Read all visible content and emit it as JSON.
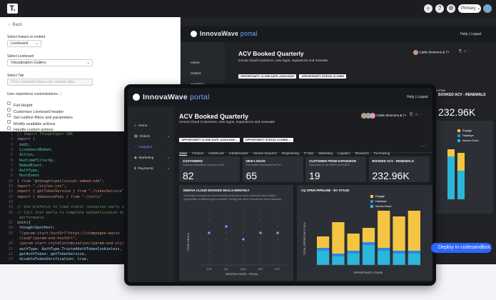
{
  "colors": {
    "accent": "#2b66ff",
    "yellow": "#f4c542",
    "blue": "#2f86e6",
    "cyan": "#2bb7d9",
    "dark": "#1b1d21"
  },
  "topbar": {
    "logo": "T.",
    "icons": [
      "search-icon",
      "help-icon",
      "settings-icon"
    ],
    "primary_label": "Primary",
    "primary_caret": "⌄"
  },
  "left": {
    "back": "Back",
    "feature_label": "Select feature to embed",
    "feature_value": "Liveboard",
    "liveboard_label": "Select Liveboard",
    "liveboard_value": "Visualization Gallery",
    "tab_label": "Select Tab",
    "tab_placeholder": "This Liveboard does not contain tabs",
    "ux_label": "User experience customizations",
    "options": [
      "Full Height",
      "Customize Liveboard header",
      "Set runtime filters and parameters",
      "Modify available actions",
      "Handle custom actions"
    ]
  },
  "code": [
    {
      "n": "1",
      "t": "// Import ThoughtSpot SDK",
      "c": "#6a9955"
    },
    {
      "n": "2",
      "t": "import {",
      "c": "#c586c0"
    },
    {
      "n": "3",
      "t": "  init,",
      "c": "#9cdcfe"
    },
    {
      "n": "4",
      "t": "  LiveboardEmbed,",
      "c": "#4ec9b0"
    },
    {
      "n": "5",
      "t": "  Action,",
      "c": "#4ec9b0"
    },
    {
      "n": "6",
      "t": "  RuntimeFilterOp,",
      "c": "#4ec9b0"
    },
    {
      "n": "7",
      "t": "  EmbedEvent,",
      "c": "#4ec9b0"
    },
    {
      "n": "8",
      "t": "  AuthType,",
      "c": "#4ec9b0"
    },
    {
      "n": "9",
      "t": "  HostEvent",
      "c": "#4ec9b0"
    },
    {
      "n": "10",
      "t": "} from \"@thoughtspot/visual-embed-sdk\";",
      "c": "#ce9178"
    },
    {
      "n": "11",
      "t": "import \"./styles.css\";",
      "c": "#ce9178"
    },
    {
      "n": "12",
      "t": "import { getTokenService } from \"./tokenService\";",
      "c": "#ce9178"
    },
    {
      "n": "13",
      "t": "import { debounceFunc } from \"./utils\"",
      "c": "#ce9178"
    },
    {
      "n": "14",
      "t": "",
      "c": "#ddd"
    },
    {
      "n": "15",
      "t": "// Use prefetch to load static resources early and",
      "c": "#6a9955"
    },
    {
      "n": "16",
      "t": "// Call init early to complete authentication during",
      "c": "#6a9955"
    },
    {
      "n": "",
      "t": "  performance.",
      "c": "#6a9955"
    },
    {
      "n": "17",
      "t": "init({",
      "c": "#dcdcaa"
    },
    {
      "n": "18",
      "t": "  thoughtSpotHost:",
      "c": "#9cdcfe"
    },
    {
      "n": "19",
      "t": "    \"/param-start-hostUrl\"https://champagne-maste",
      "c": "#ce9178"
    },
    {
      "n": "",
      "t": "  cloud\"/param-end-hostUrl\",",
      "c": "#ce9178"
    },
    {
      "n": "20",
      "t": "  /param-start-styleCustomization//param-end-style",
      "c": "#ce9178"
    },
    {
      "n": "21",
      "t": "  authType: AuthType.TrustedAuthTokenCookieless,",
      "c": "#9cdcfe"
    },
    {
      "n": "22",
      "t": "  getAuthToken: getTokenService,",
      "c": "#9cdcfe"
    },
    {
      "n": "23",
      "t": "  disableTokenVerification: true,",
      "c": "#9cdcfe"
    }
  ],
  "app": {
    "brand": "InnovaWave",
    "brand_sub": "portal",
    "help": "Help",
    "sep": "|",
    "logout": "Logout",
    "nav": [
      "Home",
      "Orders",
      "Analytics",
      "Marketing",
      "Payments"
    ],
    "title": "ACV Booked Quarterly",
    "subtitle": "Innova Cloud Customers, new logos, expansions and renewals",
    "users": "Carlie Simmons & 7+",
    "filters": [
      {
        "k": "OPPORTUNITY CLOSE DATE",
        "v": "=01/01/2025"
      },
      {
        "k": "OPPORTUNITY STATUS",
        "v": "CLOSED"
      }
    ],
    "tabs": [
      "Sales",
      "Finance",
      "Healthcare",
      "Infrastructure",
      "Human resource",
      "Engineering",
      "IT Ops",
      "Marketing",
      "Logistics",
      "Research",
      "Purchasing"
    ],
    "kpis": [
      {
        "t": "CUSTOMERS",
        "s": "Customer Acquisition Cost per month",
        "v": "82"
      },
      {
        "t": "NEW LOGOS",
        "s": "First dealers that started as PoC",
        "v": "65"
      },
      {
        "t": "CUSTOMER FROM EXPANSION",
        "s": "Data totals for the EMOS and EMOS",
        "v": "19"
      },
      {
        "t": "BOOKED ACV - RENEWALS",
        "s": "",
        "v": "232.96K"
      }
    ],
    "back_kpi_title": "BOOKED ACV - RENEWALS",
    "back_kpi_value": "232.96K",
    "chart1": {
      "title": "INNOVA CLOUD BOOKED DEALS MONTHLY",
      "desc": "Total might not equal our cloud customer count since some customers have multiple opportunities of different types example: Certegy has cloud renewal and cloud expansion",
      "ylabel": "TOTAL DEALS",
      "xlabel": "MONTHLY DATE - FISCAL"
    },
    "chart2": {
      "title": "CQ OPEN PIPELINE - BY STAGE",
      "ylabel": "TOTAL OPPORTUNITY ACV",
      "xlabel": "OPPORTUNITY STAGE",
      "legend": [
        "Engage",
        "Hawkeye",
        "Innova Cloud"
      ]
    },
    "deploy": "Deploy in codesandbox"
  },
  "chart_data": [
    {
      "type": "scatter",
      "title": "INNOVA CLOUD BOOKED DEALS MONTHLY",
      "xlabel": "MONTHLY DATE - FISCAL",
      "ylabel": "TOTAL DEALS",
      "categories": [
        "JUN",
        "JUL",
        "AUG",
        "SEP",
        "OCT"
      ],
      "values": [
        5,
        6,
        4,
        5,
        5
      ]
    },
    {
      "type": "bar",
      "title": "CQ OPEN PIPELINE - BY STAGE",
      "xlabel": "OPPORTUNITY STAGE",
      "ylabel": "TOTAL OPPORTUNITY ACV",
      "categories": [
        "1",
        "2",
        "3",
        "4",
        "5",
        "6",
        "7"
      ],
      "series": [
        {
          "name": "Engage",
          "values": [
            20,
            55,
            30,
            25,
            65,
            60,
            70
          ]
        },
        {
          "name": "Hawkeye",
          "values": [
            5,
            5,
            5,
            5,
            5,
            5,
            5
          ]
        },
        {
          "name": "Innova Cloud",
          "values": [
            25,
            15,
            20,
            35,
            25,
            20,
            20
          ]
        }
      ]
    }
  ]
}
